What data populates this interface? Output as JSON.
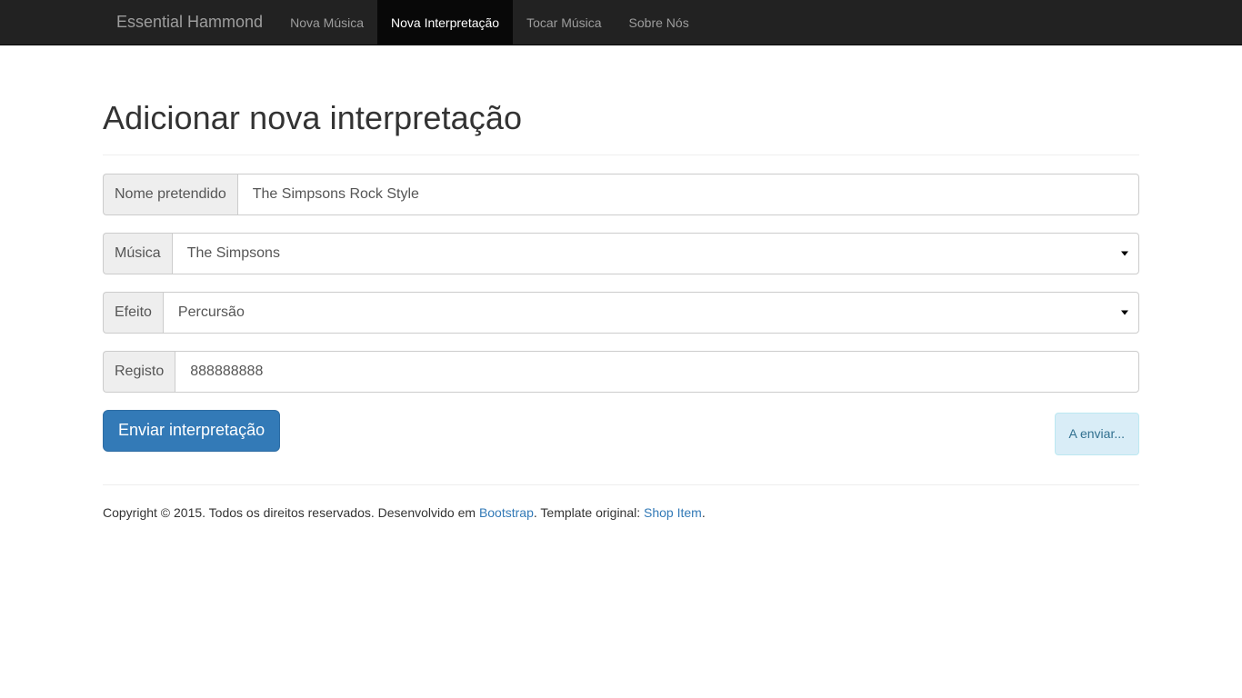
{
  "navbar": {
    "brand": "Essential Hammond",
    "items": [
      {
        "label": "Nova Música",
        "active": false
      },
      {
        "label": "Nova Interpretação",
        "active": true
      },
      {
        "label": "Tocar Música",
        "active": false
      },
      {
        "label": "Sobre Nós",
        "active": false
      }
    ],
    "background_color": "#222222",
    "active_background_color": "#080808",
    "link_color": "#9d9d9d",
    "active_link_color": "#ffffff"
  },
  "page": {
    "title": "Adicionar nova interpretação"
  },
  "form": {
    "fields": [
      {
        "addon_label": "Nome pretendido",
        "type": "text",
        "value": "The Simpsons Rock Style",
        "placeholder": ""
      },
      {
        "addon_label": "Música",
        "type": "select",
        "value": "The Simpsons",
        "options": [
          "The Simpsons"
        ]
      },
      {
        "addon_label": "Efeito",
        "type": "select",
        "value": "Percursão",
        "options": [
          "Percursão"
        ]
      },
      {
        "addon_label": "Registo",
        "type": "text",
        "value": "888888888",
        "placeholder": ""
      }
    ],
    "submit_label": "Enviar interpretação",
    "status_message": "A enviar...",
    "submit_color": "#337ab7",
    "status_background_color": "#d9edf7",
    "status_text_color": "#31708f"
  },
  "footer": {
    "text_before": "Copyright © 2015. Todos os direitos reservados. Desenvolvido em ",
    "link1": "Bootstrap",
    "text_middle": ". Template original: ",
    "link2": "Shop Item",
    "text_end": ".",
    "link_color": "#337ab7"
  }
}
